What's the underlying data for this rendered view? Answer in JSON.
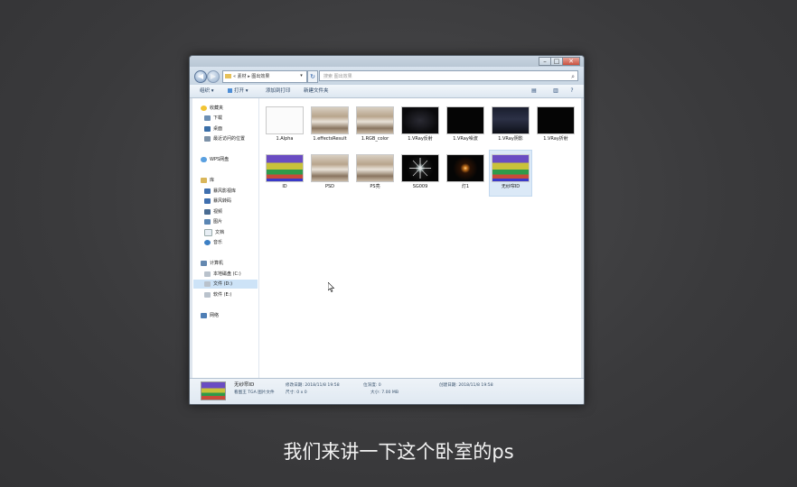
{
  "address": {
    "path": "« 素材 ▸ 图出效果",
    "search_placeholder": "搜索 图出效果"
  },
  "toolbar": {
    "organize": "组织 ▾",
    "open": "打开 ▾",
    "share": "添加到打印",
    "new_folder": "新建文件夹"
  },
  "nav": {
    "favorites": "收藏夹",
    "downloads": "下载",
    "desktop": "桌面",
    "recent": "最近访问的位置",
    "wps": "WPS网盘",
    "libraries": "库",
    "baofeng": "暴风影视库",
    "baofeng2": "暴风转码",
    "videos": "视频",
    "pictures": "图片",
    "documents": "文档",
    "music": "音乐",
    "computer": "计算机",
    "drive_c": "本地磁盘 (C:)",
    "drive_d": "文件 (D:)",
    "drive_e": "软件 (E:)",
    "network": "网络"
  },
  "files": [
    {
      "label": "1.Alpha",
      "thumb": "white"
    },
    {
      "label": "1.effectsResult",
      "thumb": "room"
    },
    {
      "label": "1.RGB_color",
      "thumb": "room"
    },
    {
      "label": "1.VRay反射",
      "thumb": "dark"
    },
    {
      "label": "1.VRay噪波",
      "thumb": "black"
    },
    {
      "label": "1.VRay阴影",
      "thumb": "darkroom"
    },
    {
      "label": "1.VRay折射",
      "thumb": "black"
    },
    {
      "label": "ID",
      "thumb": "id"
    },
    {
      "label": "PSD",
      "thumb": "room"
    },
    {
      "label": "PS亮",
      "thumb": "room"
    },
    {
      "label": "SG009",
      "thumb": "star"
    },
    {
      "label": "灯1",
      "thumb": "glow"
    },
    {
      "label": "无纱帘ID",
      "thumb": "id"
    }
  ],
  "status": {
    "name": "无纱帘ID",
    "type": "看图王 TGA 图片文件",
    "modified": "修改日期: 2018/11/8 19:58",
    "dimensions": "尺寸: 0 x 0",
    "rating": "位深度: 0",
    "size": "大小: 7.00 MB",
    "created": "创建日期: 2018/11/8 19:58"
  },
  "subtitle": "我们来讲一下这个卧室的ps",
  "colors": {
    "desktop": "#3b3b3d",
    "window_frame": "#dfe6ee",
    "selection": "#cde3f7"
  }
}
